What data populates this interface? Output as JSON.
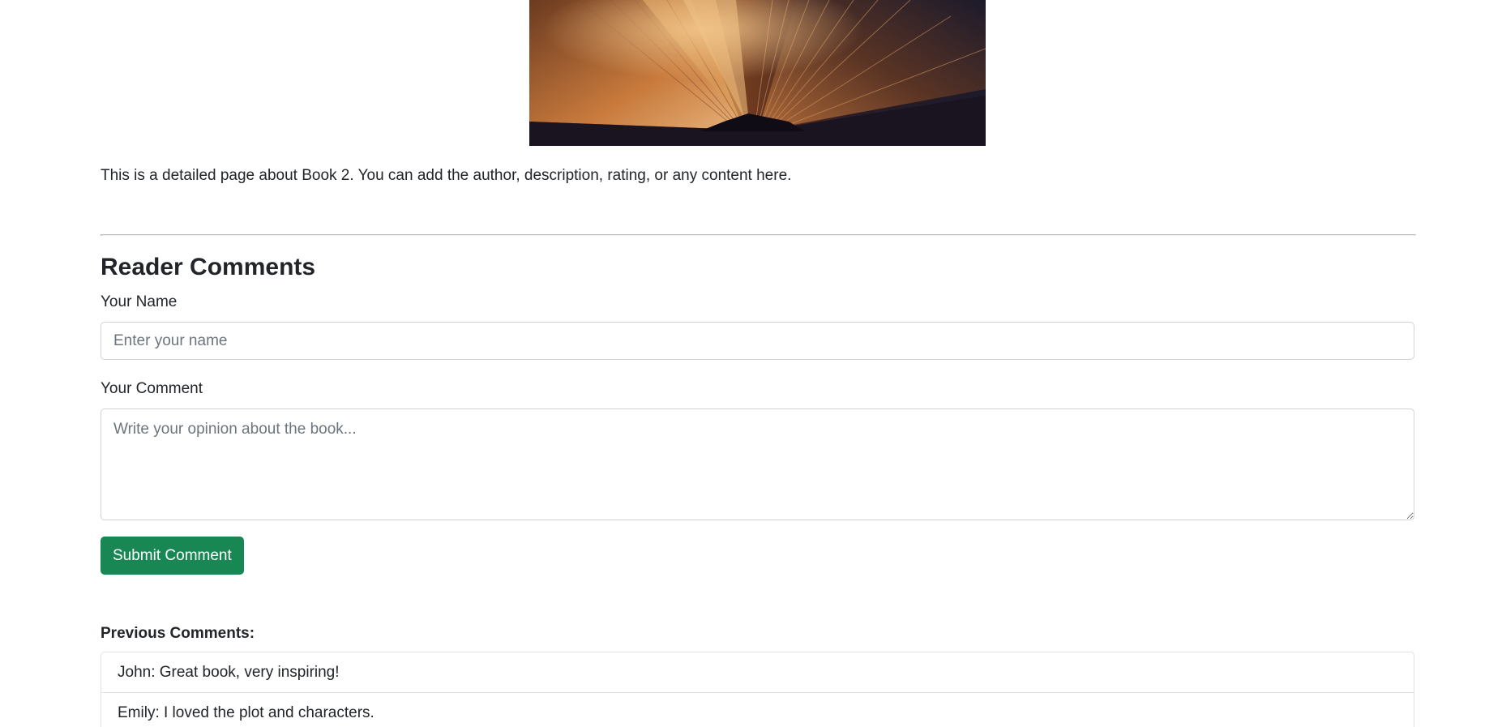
{
  "hero_image": {
    "icon": "open-book-photo",
    "colors": {
      "dark": "#1c1a2b",
      "warm": "#c87a3c",
      "light": "#e7b27a"
    }
  },
  "book": {
    "description": "This is a detailed page about Book 2. You can add the author, description, rating, or any content here."
  },
  "comments_section": {
    "title": "Reader Comments",
    "name_label": "Your Name",
    "name_placeholder": "Enter your name",
    "comment_label": "Your Comment",
    "comment_placeholder": "Write your opinion about the book...",
    "submit_label": "Submit Comment",
    "submit_color": "#198754",
    "previous_title": "Previous Comments:",
    "previous": [
      "John: Great book, very inspiring!",
      "Emily: I loved the plot and characters."
    ]
  }
}
